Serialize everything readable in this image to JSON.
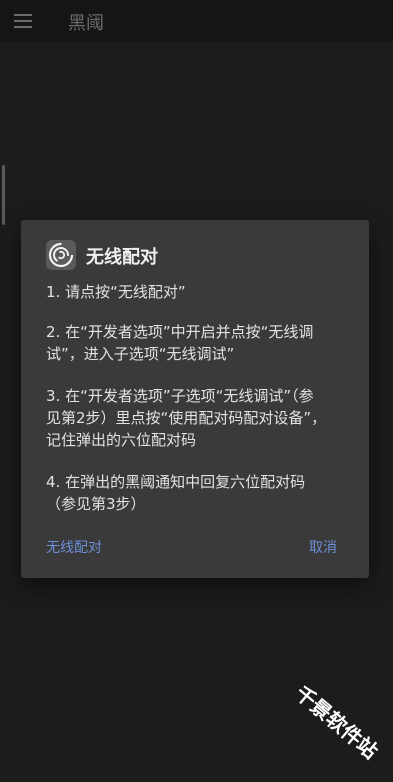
{
  "appbar": {
    "title": "黑阈",
    "menu_icon": "hamburger-menu-icon"
  },
  "dialog": {
    "logo_icon": "swirl-logo-icon",
    "title": "无线配对",
    "steps": [
      "1. 请点按“无线配对”",
      "2. 在“开发者选项”中开启并点按“无线调\n试”，进入子选项“无线调试”",
      "3. 在“开发者选项”子选项“无线调试”（参\n见第2步）里点按“使用配对码配对设备”，\n记住弹出的六位配对码",
      "4. 在弹出的黑阈通知中回复六位配对码\n（参见第3步）"
    ],
    "positive_button": "无线配对",
    "negative_button": "取消"
  },
  "watermark": {
    "text": "千景软件站"
  },
  "colors": {
    "background": "#1c1c1c",
    "appbar": "#151515",
    "dialog": "#3a3a3a",
    "accent": "#6c8fd8",
    "text": "#e2e2e2"
  }
}
